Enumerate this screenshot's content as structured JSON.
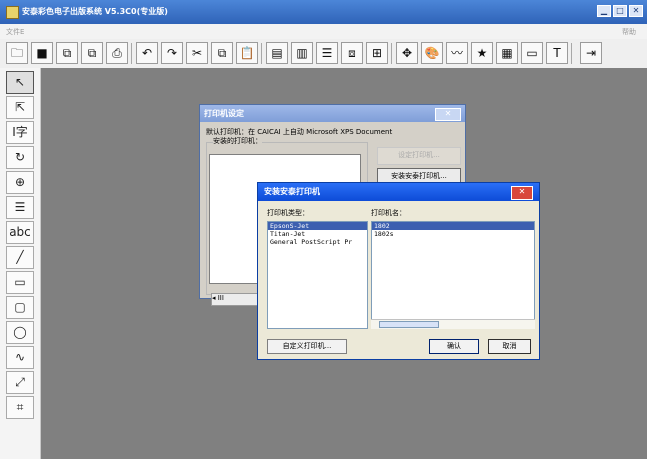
{
  "window": {
    "title": "安泰彩色电子出版系统 V5.3C0(专业版)"
  },
  "menubar": {
    "left": "文件E",
    "right": "帮助"
  },
  "toolbar": {
    "icons": [
      "folder-open-icon",
      "save-icon",
      "export-icon",
      "import-icon",
      "print-icon",
      "undo-icon",
      "redo-icon",
      "cut-icon",
      "copy-icon",
      "paste-icon",
      "text-frame-icon",
      "text-frame2-icon",
      "paragraph-icon",
      "layout-icon",
      "window-icon",
      "move-icon",
      "color-icon",
      "line-color-icon",
      "star-icon",
      "grid-icon",
      "page-icon",
      "text-box-icon",
      "export2-icon"
    ]
  },
  "leftbar": {
    "tools": [
      {
        "name": "select-arrow-icon",
        "text": "↖",
        "active": true
      },
      {
        "name": "direct-select-icon",
        "text": "⇱",
        "active": false
      },
      {
        "name": "text-tool-icon",
        "text": "I字",
        "active": false
      },
      {
        "name": "rotate-icon",
        "text": "↻",
        "active": false
      },
      {
        "name": "zoom-icon",
        "text": "⊕",
        "active": false
      },
      {
        "name": "table-icon",
        "text": "☰",
        "active": false
      },
      {
        "name": "abc-tool-icon",
        "text": "abc",
        "active": false
      },
      {
        "name": "line-tool-icon",
        "text": "╱",
        "active": false
      },
      {
        "name": "rectangle-tool-icon",
        "text": "▭",
        "active": false
      },
      {
        "name": "rounded-rect-tool-icon",
        "text": "▢",
        "active": false
      },
      {
        "name": "ellipse-tool-icon",
        "text": "◯",
        "active": false
      },
      {
        "name": "curve-tool-icon",
        "text": "∿",
        "active": false
      },
      {
        "name": "pen-tool-icon",
        "text": "⤢",
        "active": false
      },
      {
        "name": "measure-tool-icon",
        "text": "⌗",
        "active": false
      }
    ]
  },
  "printerSetup": {
    "title": "打印机设定",
    "defaultPrinterText": "默认打印机：在 CAICAI 上自动 Microsoft XPS Document",
    "installedLabel": "安装的打印机：",
    "setupBtn": "设定打印机...",
    "installBtn": "安装安泰打印机..."
  },
  "installDialog": {
    "title": "安装安泰打印机",
    "typeLabel": "打印机类型：",
    "nameLabel": "打印机名：",
    "types": [
      "EpsonS-Jet",
      "Titan-Jet",
      "General PostScript Pr"
    ],
    "names": [
      "1802",
      "1802s"
    ],
    "customBtn": "自定义打印机...",
    "okBtn": "确认",
    "cancelBtn": "取消"
  }
}
